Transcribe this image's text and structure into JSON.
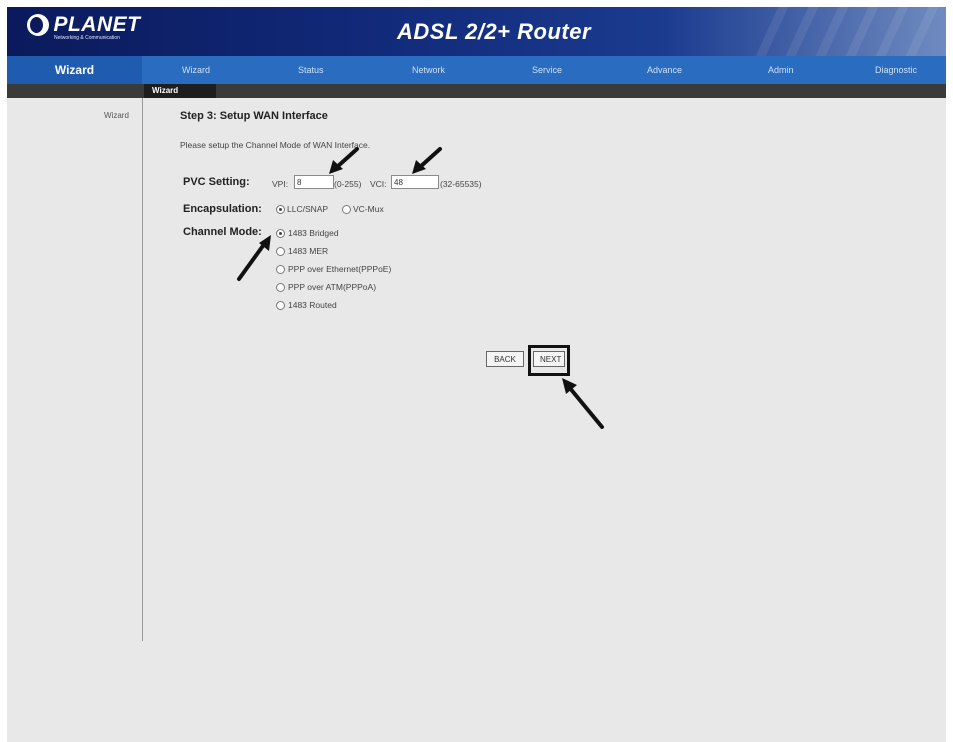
{
  "header": {
    "brand": "PLANET",
    "brand_tagline": "Networking & Communication",
    "title": "ADSL 2/2+ Router"
  },
  "nav": {
    "current": "Wizard",
    "items": [
      "Wizard",
      "Status",
      "Network",
      "Service",
      "Advance",
      "Admin",
      "Diagnostic"
    ]
  },
  "subnav": {
    "active_tab": "Wizard"
  },
  "sidebar": {
    "label": "Wizard"
  },
  "content": {
    "step_title": "Step 3: Setup WAN Interface",
    "instruction": "Please setup the Channel Mode of WAN Interface.",
    "pvc": {
      "label": "PVC Setting:",
      "vpi_label": "VPI:",
      "vpi_value": "8",
      "vpi_range": "(0-255)",
      "vci_label": "VCI:",
      "vci_value": "48",
      "vci_range": "(32-65535)"
    },
    "encapsulation": {
      "label": "Encapsulation:",
      "options": [
        "LLC/SNAP",
        "VC-Mux"
      ],
      "selected": "LLC/SNAP"
    },
    "channel_mode": {
      "label": "Channel Mode:",
      "options": [
        "1483 Bridged",
        "1483 MER",
        "PPP over Ethernet(PPPoE)",
        "PPP over ATM(PPPoA)",
        "1483 Routed"
      ],
      "selected": "1483 Bridged"
    },
    "buttons": {
      "back": "BACK",
      "next": "NEXT"
    }
  },
  "colors": {
    "banner": "#0a1a5c",
    "nav": "#2a6cc0",
    "subnav": "#3a3a3a",
    "background": "#e8e8e8"
  }
}
